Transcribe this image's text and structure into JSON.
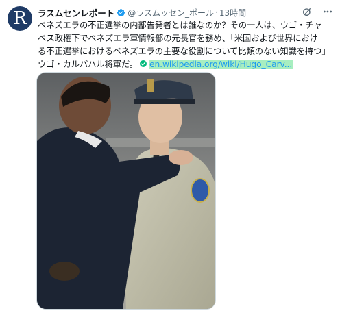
{
  "author": {
    "avatar_letter": "R",
    "name": "ラスムセンレポート",
    "handle": "@ラスムッセン_ポール",
    "separator": "·",
    "timestamp": "13時間"
  },
  "tweet": {
    "lines": [
      "ベネズエラの不正選挙の内部告発者とは誰なのか？その一人は、ウゴ・チャ",
      "ベス政権下でベネズエラ軍情報部の元長官を務め、「米国および世界におけ",
      "る不正選挙におけるベネズエラの主要な役割について比類のない知識を持つ」"
    ],
    "last_line_text": "ウゴ・カルバハル将軍だ。",
    "link_text": "en.wikipedia.org/wiki/Hugo_Carv..."
  },
  "icons": {
    "verified": "verified-badge-icon",
    "grok": "grok-icon",
    "more": "more-icon",
    "check": "check-mark-icon"
  },
  "colors": {
    "verified": "#1d9bf0",
    "link": "#1d9bf0",
    "link_highlight": "#a8eec0",
    "check": "#00ba7c",
    "avatar_bg": "#1f3b66"
  }
}
